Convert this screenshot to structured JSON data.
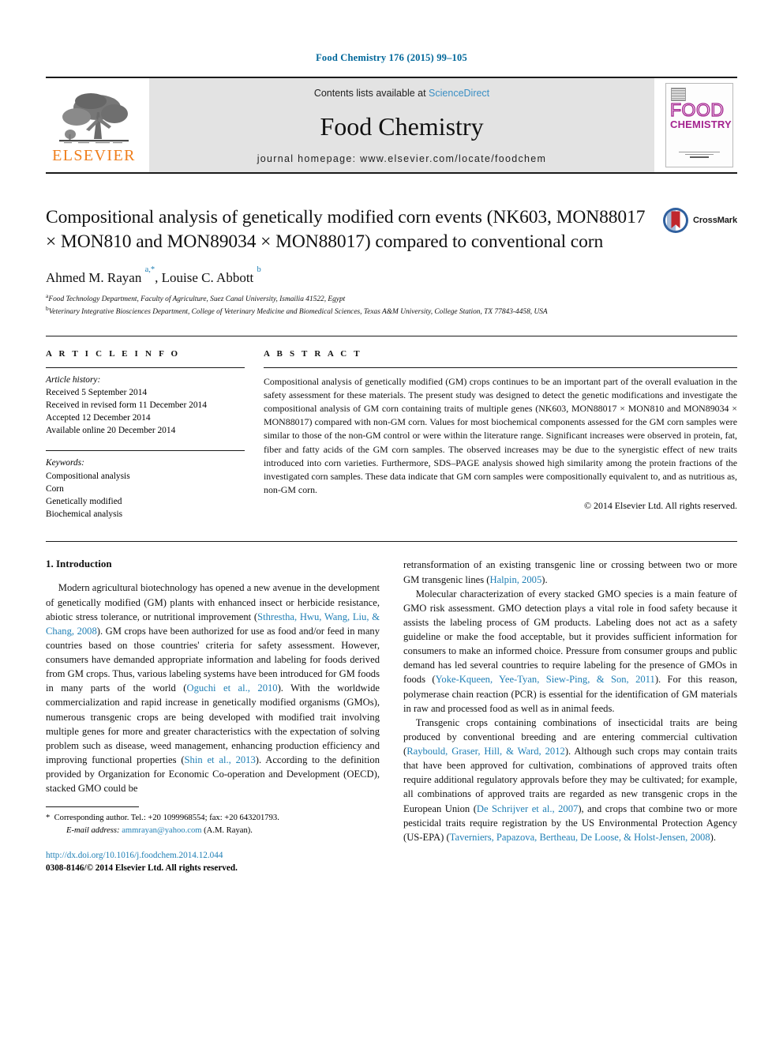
{
  "running_head": "Food Chemistry 176 (2015) 99–105",
  "masthead": {
    "contents_prefix": "Contents lists available at ",
    "sciencedirect": "ScienceDirect",
    "journal_name": "Food Chemistry",
    "homepage": "journal homepage: www.elsevier.com/locate/foodchem",
    "publisher_logo_text": "ELSEVIER",
    "cover_title_line1": "FOOD",
    "cover_title_line2": "CHEMISTRY"
  },
  "article": {
    "title": "Compositional analysis of genetically modified corn events (NK603, MON88017 × MON810 and MON89034 × MON88017) compared to conventional corn",
    "crossmark_label": "CrossMark",
    "authors_html": "Ahmed M. Rayan <sup>a,*</sup>, Louise C. Abbott <sup>b</sup>",
    "affiliation_a": "Food Technology Department, Faculty of Agriculture, Suez Canal University, Ismailia 41522, Egypt",
    "affiliation_b": "Veterinary Integrative Biosciences Department, College of Veterinary Medicine and Biomedical Sciences, Texas A&M University, College Station, TX 77843-4458, USA"
  },
  "article_info": {
    "heading": "A R T I C L E   I N F O",
    "history_label": "Article history:",
    "history": [
      "Received 5 September 2014",
      "Received in revised form 11 December 2014",
      "Accepted 12 December 2014",
      "Available online 20 December 2014"
    ],
    "keywords_label": "Keywords:",
    "keywords": [
      "Compositional analysis",
      "Corn",
      "Genetically modified",
      "Biochemical analysis"
    ]
  },
  "abstract": {
    "heading": "A B S T R A C T",
    "text": "Compositional analysis of genetically modified (GM) crops continues to be an important part of the overall evaluation in the safety assessment for these materials. The present study was designed to detect the genetic modifications and investigate the compositional analysis of GM corn containing traits of multiple genes (NK603, MON88017 × MON810 and MON89034 × MON88017) compared with non-GM corn. Values for most biochemical components assessed for the GM corn samples were similar to those of the non-GM control or were within the literature range. Significant increases were observed in protein, fat, fiber and fatty acids of the GM corn samples. The observed increases may be due to the synergistic effect of new traits introduced into corn varieties. Furthermore, SDS–PAGE analysis showed high similarity among the protein fractions of the investigated corn samples. These data indicate that GM corn samples were compositionally equivalent to, and as nutritious as, non-GM corn.",
    "copyright": "© 2014 Elsevier Ltd. All rights reserved."
  },
  "body": {
    "section_heading": "1. Introduction",
    "left_paragraph_1_part1": "Modern agricultural biotechnology has opened a new avenue in the development of genetically modified (GM) plants with enhanced insect or herbicide resistance, abiotic stress tolerance, or nutritional improvement (",
    "left_ref_1": "Sthrestha, Hwu, Wang, Liu, & Chang, 2008",
    "left_paragraph_1_part2": "). GM crops have been authorized for use as food and/or feed in many countries based on those countries' criteria for safety assessment. However, consumers have demanded appropriate information and labeling for foods derived from GM crops. Thus, various labeling systems have been introduced for GM foods in many parts of the world (",
    "left_ref_2": "Oguchi et al., 2010",
    "left_paragraph_1_part3": "). With the worldwide commercialization and rapid increase in genetically modified organisms (GMOs), numerous transgenic crops are being developed with modified trait involving multiple genes for more and greater characteristics with the expectation of solving problem such as disease, weed management, enhancing production efficiency and improving functional properties (",
    "left_ref_3": "Shin et al., 2013",
    "left_paragraph_1_part4": "). According to the definition provided by Organization for Economic Co-operation and Development (OECD), stacked GMO could be",
    "right_paragraph_1_part1": "retransformation of an existing transgenic line or crossing between two or more GM transgenic lines (",
    "right_ref_1": "Halpin, 2005",
    "right_paragraph_1_part2": ").",
    "right_paragraph_2_part1": "Molecular characterization of every stacked GMO species is a main feature of GMO risk assessment. GMO detection plays a vital role in food safety because it assists the labeling process of GM products. Labeling does not act as a safety guideline or make the food acceptable, but it provides sufficient information for consumers to make an informed choice. Pressure from consumer groups and public demand has led several countries to require labeling for the presence of GMOs in foods (",
    "right_ref_2": "Yoke-Kqueen, Yee-Tyan, Siew-Ping, & Son, 2011",
    "right_paragraph_2_part2": "). For this reason, polymerase chain reaction (PCR) is essential for the identification of GM materials in raw and processed food as well as in animal feeds.",
    "right_paragraph_3_part1": "Transgenic crops containing combinations of insecticidal traits are being produced by conventional breeding and are entering commercial cultivation (",
    "right_ref_3": "Raybould, Graser, Hill, & Ward, 2012",
    "right_paragraph_3_part2": "). Although such crops may contain traits that have been approved for cultivation, combinations of approved traits often require additional regulatory approvals before they may be cultivated; for example, all combinations of approved traits are regarded as new transgenic crops in the European Union (",
    "right_ref_4": "De Schrijver et al., 2007",
    "right_paragraph_3_part3": "), and crops that combine two or more pesticidal traits require registration by the US Environmental Protection Agency (US-EPA) (",
    "right_ref_5": "Taverniers, Papazova, Bertheau, De Loose, & Holst-Jensen, 2008",
    "right_paragraph_3_part4": ")."
  },
  "footer": {
    "corresponding_marker": "*",
    "corresponding_text": "Corresponding author. Tel.: +20 1099968554; fax: +20 643201793.",
    "email_label": "E-mail address:",
    "email": "ammrayan@yahoo.com",
    "email_suffix": "(A.M. Rayan).",
    "doi_url": "http://dx.doi.org/10.1016/j.foodchem.2014.12.044",
    "issn_line": "0308-8146/© 2014 Elsevier Ltd. All rights reserved."
  },
  "colors": {
    "link": "#1f7fb5",
    "running_head": "#00679a",
    "elsevier_orange": "#ef7d1a",
    "cover_magenta": "#a4238f"
  }
}
